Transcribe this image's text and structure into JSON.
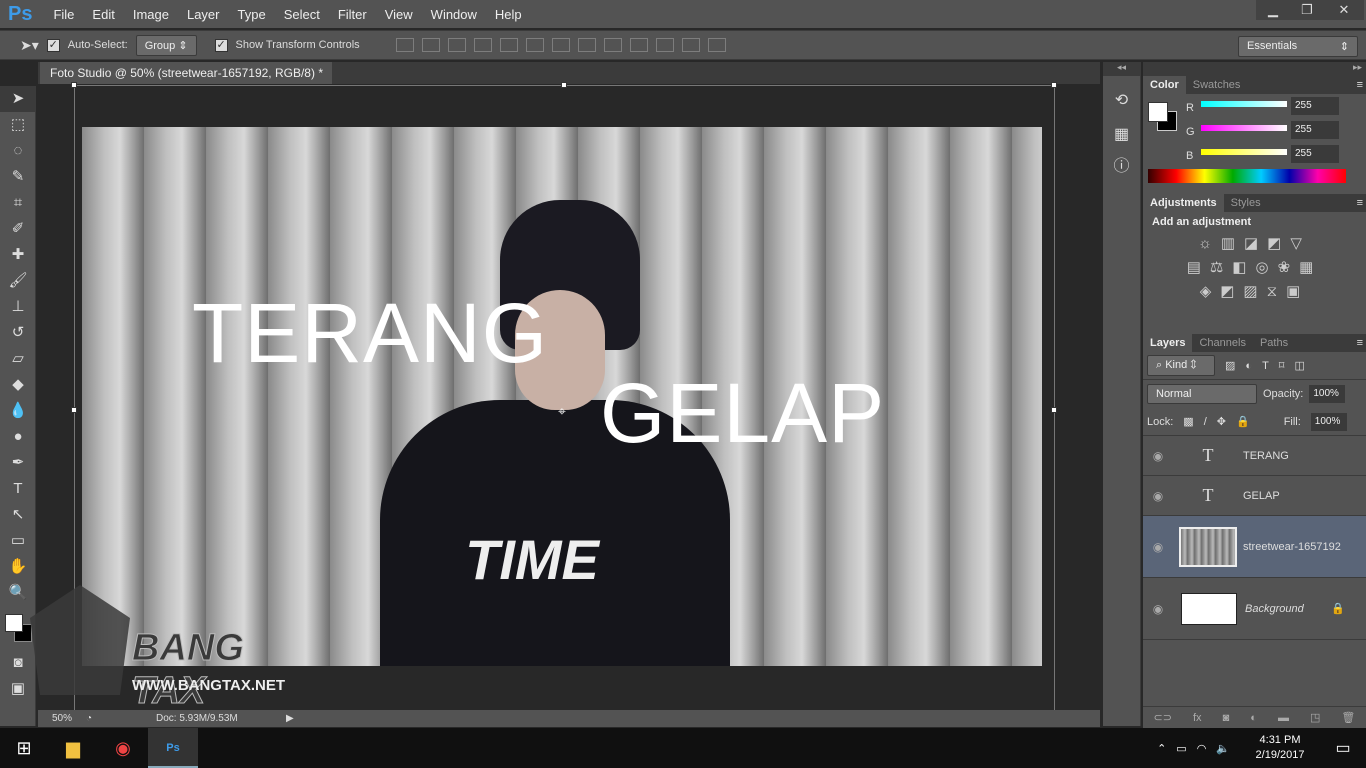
{
  "app": {
    "logo": "Ps"
  },
  "menu": [
    "File",
    "Edit",
    "Image",
    "Layer",
    "Type",
    "Select",
    "Filter",
    "View",
    "Window",
    "Help"
  ],
  "window_controls": {
    "minimize": "▁",
    "restore": "❐",
    "close": "✕"
  },
  "options": {
    "auto_select_label": "Auto-Select:",
    "auto_select_checked": true,
    "auto_select_value": "Group",
    "show_transform_label": "Show Transform Controls",
    "show_transform_checked": true,
    "workspace": "Essentials"
  },
  "document": {
    "tab_title": "Foto Studio @ 50% (streetwear-1657192, RGB/8) *",
    "close": "×",
    "text_layers": [
      "TERANG",
      "GELAP"
    ]
  },
  "status": {
    "zoom": "50%",
    "doc": "Doc: 5.93M/9.53M"
  },
  "watermark": {
    "brand": "BANG TAX",
    "url": "WWW.BANGTAX.NET"
  },
  "color_panel": {
    "tabs": [
      "Color",
      "Swatches"
    ],
    "r_label": "R",
    "g_label": "G",
    "b_label": "B",
    "r": "255",
    "g": "255",
    "b": "255",
    "foreground": "#ffffff",
    "background": "#000000"
  },
  "adjustments_panel": {
    "tabs": [
      "Adjustments",
      "Styles"
    ],
    "heading": "Add an adjustment"
  },
  "layers_panel": {
    "tabs": [
      "Layers",
      "Channels",
      "Paths"
    ],
    "filter": "Kind",
    "blend_mode": "Normal",
    "opacity_label": "Opacity:",
    "opacity": "100%",
    "lock_label": "Lock:",
    "fill_label": "Fill:",
    "fill": "100%",
    "layers": [
      {
        "name": "TERANG",
        "type": "text",
        "selected": false
      },
      {
        "name": "GELAP",
        "type": "text",
        "selected": false
      },
      {
        "name": "streetwear-1657192",
        "type": "smart-object",
        "selected": true
      },
      {
        "name": "Background",
        "type": "background",
        "selected": false
      }
    ]
  },
  "taskbar": {
    "time": "4:31 PM",
    "date": "2/19/2017"
  },
  "colors": {
    "accent": "#3d9be9",
    "selected_layer": "#5a6578"
  }
}
